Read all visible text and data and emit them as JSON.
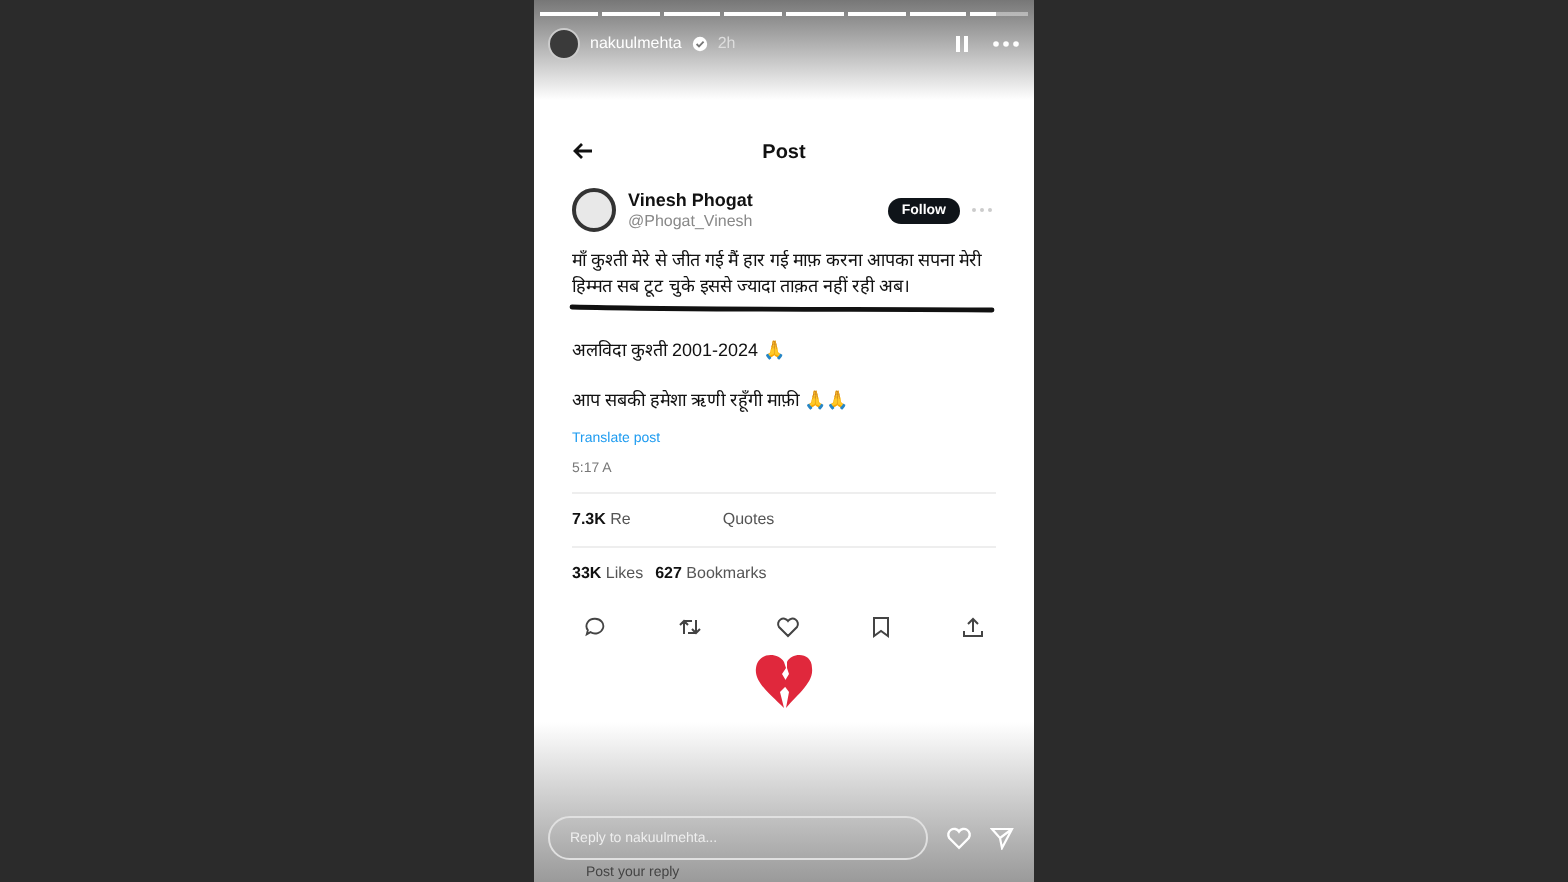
{
  "story": {
    "progress": [
      {
        "level": 1
      },
      {
        "level": 1
      },
      {
        "level": 1
      },
      {
        "level": 1
      },
      {
        "level": 1
      },
      {
        "level": 1
      },
      {
        "level": 1
      },
      {
        "level": 0.45
      }
    ],
    "username": "nakuulmehta",
    "verified": true,
    "time": "2h"
  },
  "post": {
    "title": "Post",
    "author": {
      "name": "Vinesh Phogat",
      "handle": "@Phogat_Vinesh"
    },
    "follow_label": "Follow",
    "paragraphs": [
      "माँ कुश्ती मेरे से जीत गई मैं हार गई माफ़ करना आपका सपना मेरी हिम्मत सब टूट चुके इससे ज्यादा ताक़त नहीं रही अब।",
      "अलविदा कुश्ती 2001-2024 🙏",
      "आप सबकी हमेशा ऋणी रहूँगी माफ़ी 🙏🙏"
    ],
    "translate": "Translate post",
    "timestamp": "5:17 A",
    "stats_rows": [
      [
        {
          "count": "7.3K",
          "label": "Re"
        },
        {
          "label": "Quotes"
        }
      ],
      [
        {
          "count": "33K",
          "label": "Likes"
        },
        {
          "count": "627",
          "label": "Bookmarks"
        }
      ]
    ]
  },
  "reply": {
    "placeholder": "Reply to nakuulmehta...",
    "below": "Post your reply"
  }
}
